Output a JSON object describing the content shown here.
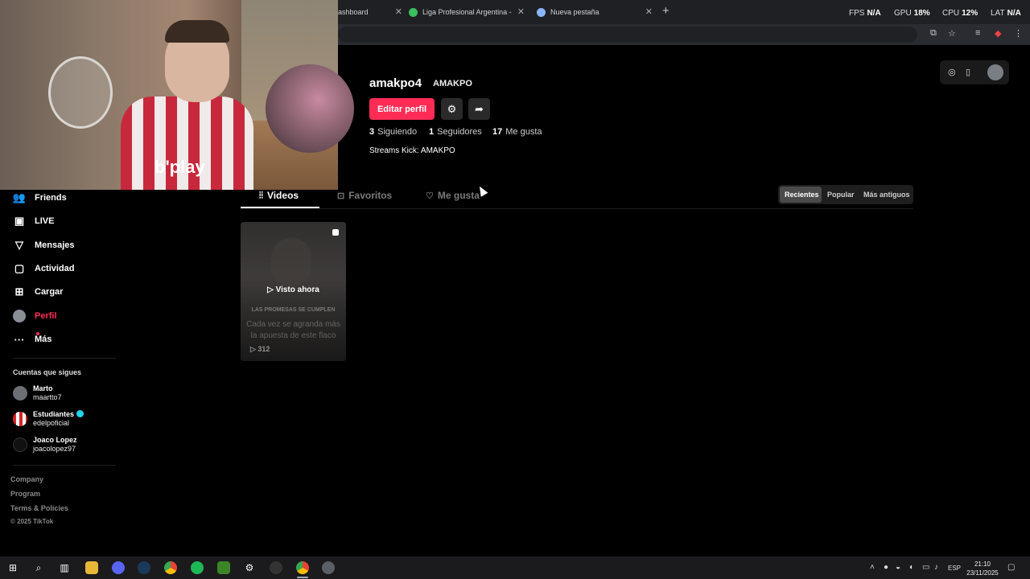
{
  "browser": {
    "tabs": [
      {
        "label": "ashboard"
      },
      {
        "label": "Liga Profesional Argentina - PC"
      },
      {
        "label": "Nueva pestaña"
      }
    ],
    "new_tab": "+"
  },
  "overlay": {
    "fps_label": "FPS",
    "fps_value": "N/A",
    "gpu_label": "GPU",
    "gpu_value": "18%",
    "cpu_label": "CPU",
    "cpu_value": "12%",
    "lat_label": "LAT",
    "lat_value": "N/A"
  },
  "webcam": {
    "jersey_text": "b'play"
  },
  "sidebar": {
    "items": [
      {
        "label": "Friends",
        "icon": "friends-icon"
      },
      {
        "label": "LIVE",
        "icon": "live-icon"
      },
      {
        "label": "Mensajes",
        "icon": "messages-icon"
      },
      {
        "label": "Actividad",
        "icon": "activity-icon"
      },
      {
        "label": "Cargar",
        "icon": "upload-icon"
      },
      {
        "label": "Perfil",
        "icon": "profile-avatar-icon",
        "active": true
      },
      {
        "label": "Más",
        "icon": "more-icon"
      }
    ],
    "following_title": "Cuentas que sigues",
    "following": [
      {
        "name": "Marto",
        "handle": "maartto7",
        "verified": false
      },
      {
        "name": "Estudiantes",
        "handle": "edelpoficial",
        "verified": true
      },
      {
        "name": "Joaco Lopez",
        "handle": "joacolopez97",
        "verified": false
      }
    ],
    "footer": [
      "Company",
      "Program",
      "Terms & Policies"
    ],
    "copyright": "© 2025 TikTok"
  },
  "profile": {
    "username": "amakpo4",
    "nickname": "AMAKPO",
    "edit_label": "Editar perfil",
    "stats": [
      {
        "value": "3",
        "label": "Siguiendo"
      },
      {
        "value": "1",
        "label": "Seguidores"
      },
      {
        "value": "17",
        "label": "Me gusta"
      }
    ],
    "bio": "Streams Kick: AMAKPO"
  },
  "content_tabs": [
    {
      "label": "Videos",
      "active": true
    },
    {
      "label": "Favoritos",
      "active": false
    },
    {
      "label": "Me gusta",
      "active": false
    }
  ],
  "sort": {
    "options": [
      "Recientes",
      "Popular",
      "Más antiguos"
    ],
    "selected": "Recientes"
  },
  "videos": [
    {
      "watched_label": "Visto ahora",
      "caption_top": "LAS PROMESAS SE CUMPLEN",
      "caption": "Cada vez se agranda más la apuesta de este flaco",
      "views": "312"
    }
  ],
  "taskbar": {
    "language": "ESP",
    "time": "21:10",
    "date": "23/11/2025"
  }
}
